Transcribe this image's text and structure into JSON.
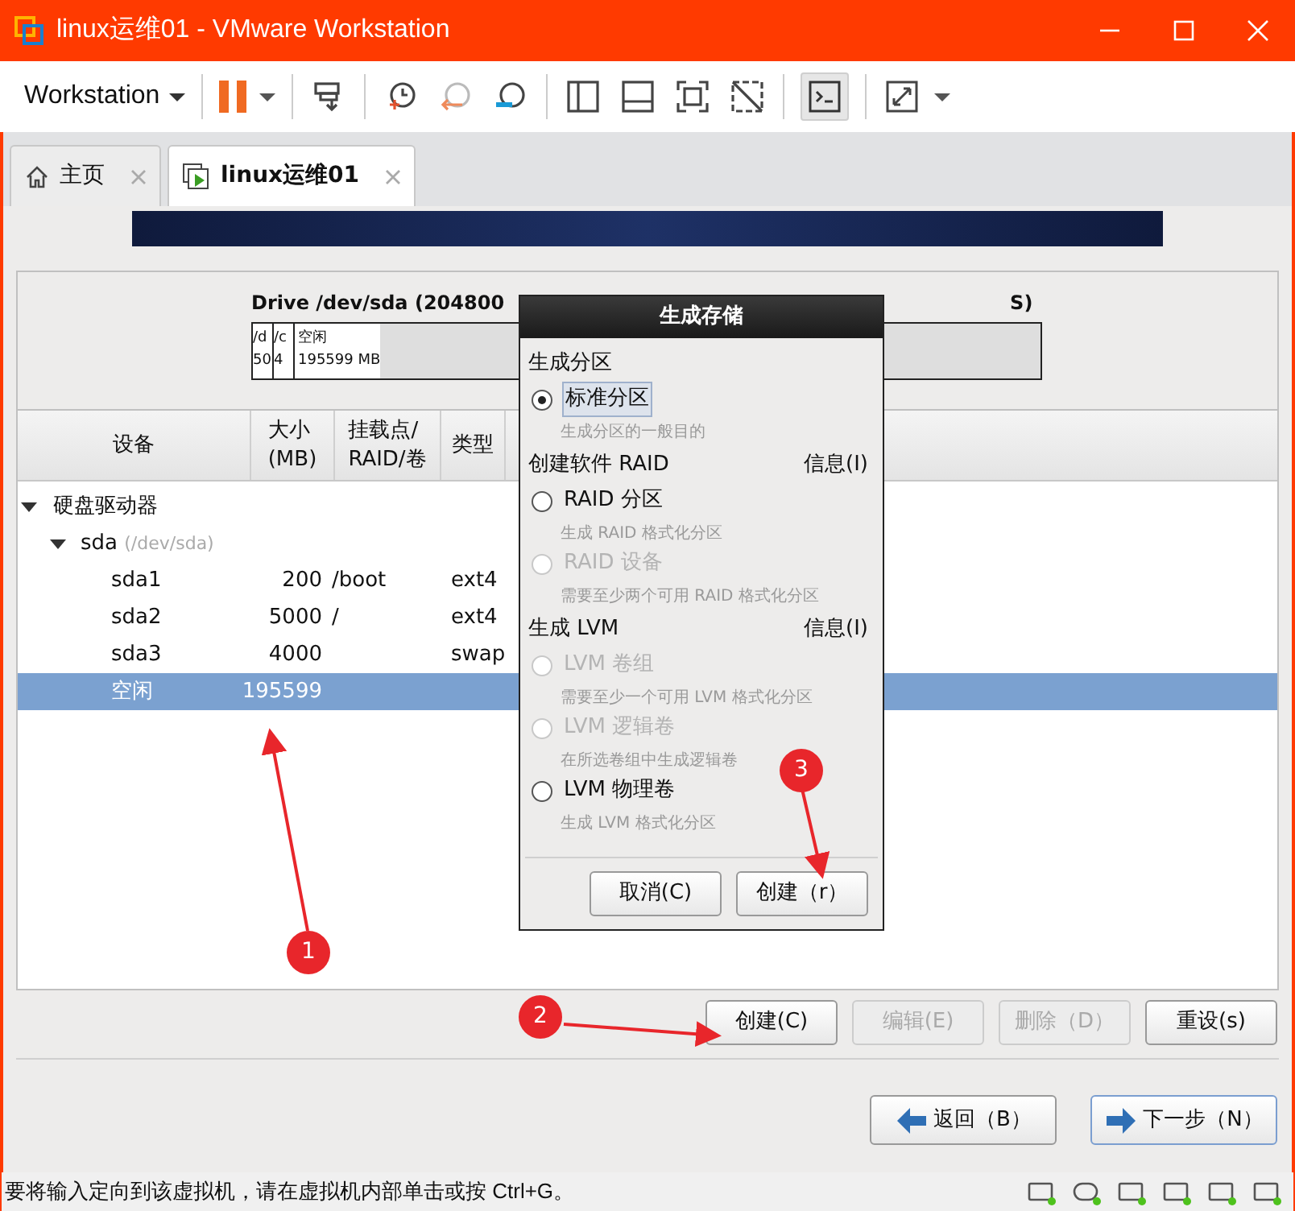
{
  "window": {
    "title": "linux运维01 - VMware Workstation"
  },
  "toolbar": {
    "menu": "Workstation"
  },
  "tabs": [
    {
      "label": "主页",
      "selected": false
    },
    {
      "label": "linux运维01",
      "selected": true
    }
  ],
  "drive": {
    "title": "Drive /dev/sda (204800",
    "title_tail": "S)",
    "segments": [
      {
        "line1": "/d",
        "line2": "50"
      },
      {
        "line1": "/c",
        "line2": "4"
      },
      {
        "line1": "空闲",
        "line2": "195599 MB"
      }
    ]
  },
  "table": {
    "columns": [
      "设备",
      "大小\n(MB)",
      "挂载点/\nRAID/卷",
      "类型"
    ],
    "rows": [
      {
        "device": "硬盘驱动器",
        "expanded": true,
        "children": [
          {
            "device": "sda",
            "note": "(/dev/sda)",
            "expanded": true,
            "children": [
              {
                "device": "sda1",
                "size": "200",
                "mount": "/boot",
                "type": "ext4",
                "selected": false
              },
              {
                "device": "sda2",
                "size": "5000",
                "mount": "/",
                "type": "ext4",
                "selected": false
              },
              {
                "device": "sda3",
                "size": "4000",
                "type": "swap",
                "selected": false
              },
              {
                "device": "空闲",
                "size": "195599",
                "selected": true
              }
            ]
          }
        ]
      }
    ]
  },
  "actions": [
    {
      "label": "创建(C)",
      "disabled": false
    },
    {
      "label": "编辑(E)",
      "disabled": true
    },
    {
      "label": "删除（D）",
      "disabled": true
    },
    {
      "label": "重设(s)",
      "disabled": false
    }
  ],
  "nav": [
    {
      "label": "返回（B）",
      "kind": "back",
      "selected": false
    },
    {
      "label": "下一步（N）",
      "kind": "next",
      "selected": true
    }
  ],
  "dialog": {
    "title": "生成存储",
    "sections": [
      {
        "heading": "生成分区",
        "options": [
          {
            "label": "标准分区",
            "hint": "生成分区的一般目的",
            "selected": true,
            "disabled": false
          }
        ]
      },
      {
        "heading": "创建软件 RAID",
        "info": "信息(I)",
        "options": [
          {
            "label": "RAID 分区",
            "hint": "生成 RAID 格式化分区",
            "selected": false,
            "disabled": false
          },
          {
            "label": "RAID 设备",
            "hint": "需要至少两个可用 RAID 格式化分区",
            "selected": false,
            "disabled": true
          }
        ]
      },
      {
        "heading": "生成 LVM",
        "info": "信息(I)",
        "options": [
          {
            "label": "LVM 卷组",
            "hint": "需要至少一个可用 LVM 格式化分区",
            "selected": false,
            "disabled": true
          },
          {
            "label": "LVM 逻辑卷",
            "hint": "在所选卷组中生成逻辑卷",
            "selected": false,
            "disabled": true
          },
          {
            "label": "LVM 物理卷",
            "hint": "生成 LVM 格式化分区",
            "selected": false,
            "disabled": false
          }
        ]
      }
    ],
    "buttons": [
      "取消(C)",
      "创建（r）"
    ]
  },
  "annotations": [
    "1",
    "2",
    "3"
  ],
  "status_bar": {
    "text": "要将输入定向到该虚拟机，请在虚拟机内部单击或按 Ctrl+G。"
  }
}
